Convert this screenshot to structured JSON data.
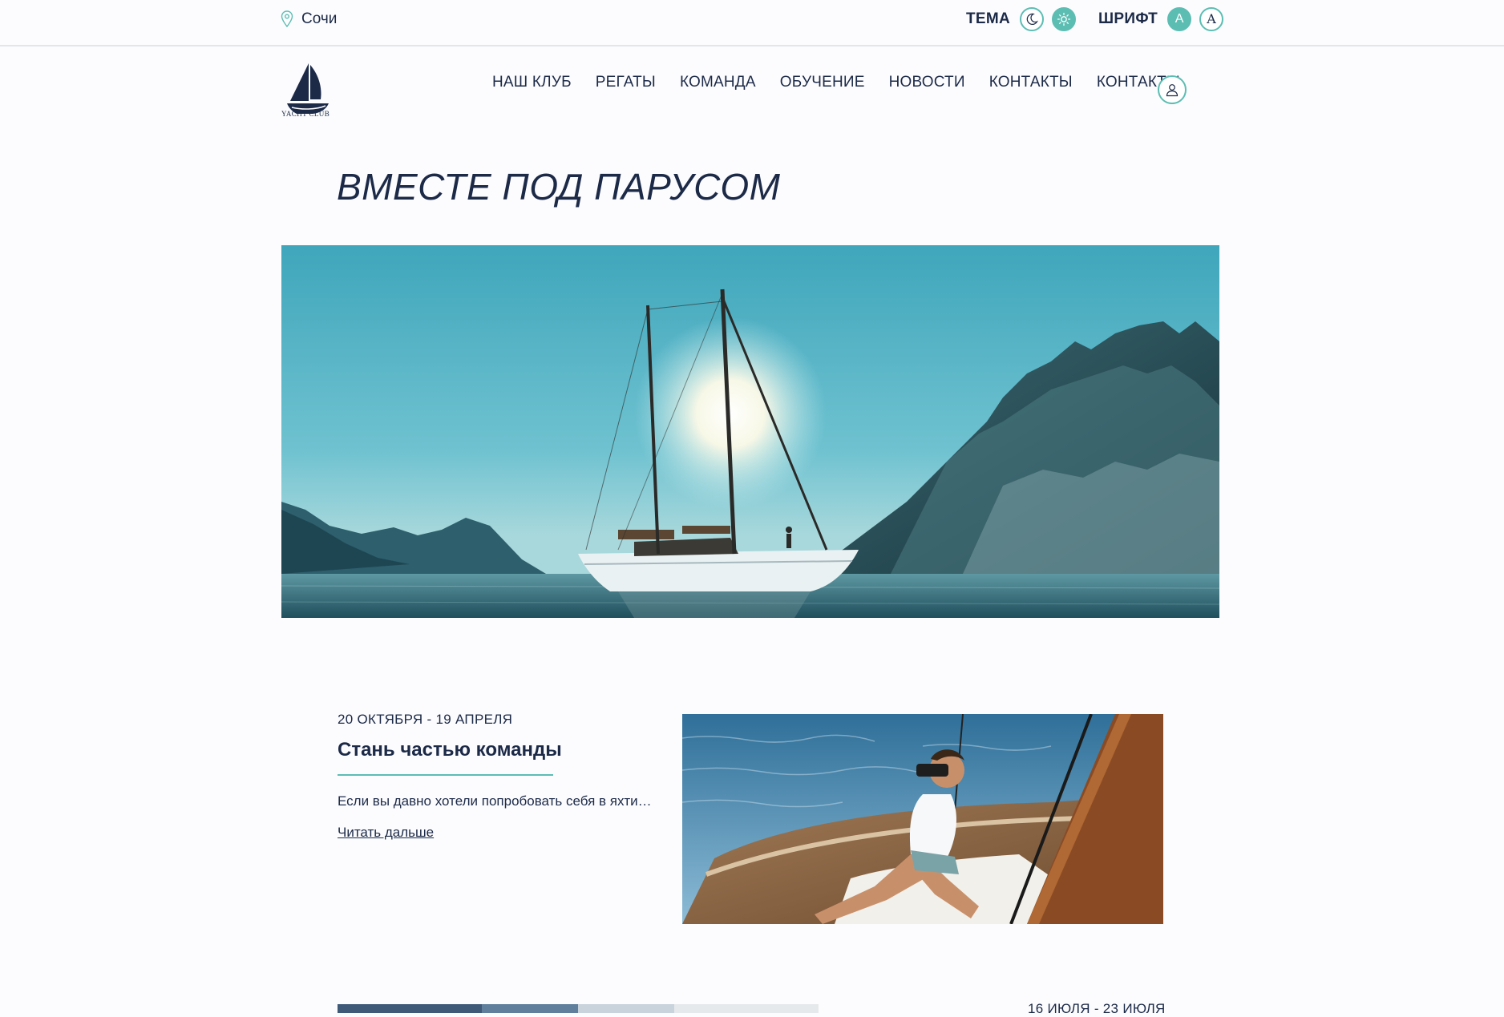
{
  "topbar": {
    "location": "Сочи",
    "location_icon": "map-pin-icon",
    "theme_label": "ТЕМА",
    "theme_icons": [
      "moon-icon",
      "sun-icon"
    ],
    "font_label": "ШРИФТ",
    "font_options": [
      "A",
      "A"
    ]
  },
  "header": {
    "logo_text": "YACHT CLUB",
    "nav": [
      {
        "label": "НАШ КЛУБ"
      },
      {
        "label": "РЕГАТЫ"
      },
      {
        "label": "КОМАНДА"
      },
      {
        "label": "ОБУЧЕНИЕ"
      },
      {
        "label": "НОВОСТИ"
      },
      {
        "label": "КОНТАКТЫ"
      },
      {
        "label": "КОНТАКТЫ"
      }
    ],
    "user_icon": "user-icon"
  },
  "hero": {
    "title": "ВМЕСТЕ ПОД ПАРУСОМ"
  },
  "cards": [
    {
      "date": "20 ОКТЯБРЯ - 19 АПРЕЛЯ",
      "title": "Стань частью команды",
      "text": "Если вы давно хотели попробовать себя в яхтинге",
      "link": "Читать дальше"
    },
    {
      "date": "16 ИЮЛЯ - 23 ИЮЛЯ"
    }
  ],
  "colors": {
    "accent": "#5cbdb3",
    "text": "#1c2a48",
    "background": "#fcfcfe"
  }
}
